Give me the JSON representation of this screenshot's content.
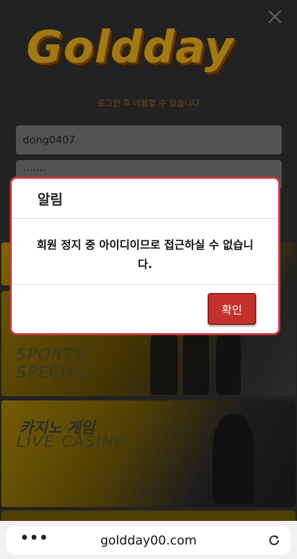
{
  "login": {
    "logo_text": "Goldday",
    "subtitle": "로그인 후 이용할 수 있습니다",
    "username_value": "dong0407",
    "password_value": "·······"
  },
  "banners": [
    {
      "title": "",
      "subtitle": ""
    },
    {
      "title": "",
      "subtitle_line1": "SPORTS",
      "subtitle_line2": "SPECIAL"
    },
    {
      "title": "카지노 게임",
      "subtitle": "LIVE CASINO"
    }
  ],
  "modal": {
    "title": "알림",
    "message": "회원 정지 중 아이디이므로 접근하실 수 없습니다.",
    "confirm_label": "확인"
  },
  "browser": {
    "menu_icon": "more-dots-icon",
    "url": "goldday00.com",
    "reload_icon": "reload-icon"
  },
  "colors": {
    "accent_gold": "#d9a21b",
    "modal_border": "#c8373b",
    "confirm_button": "#c5322e"
  }
}
